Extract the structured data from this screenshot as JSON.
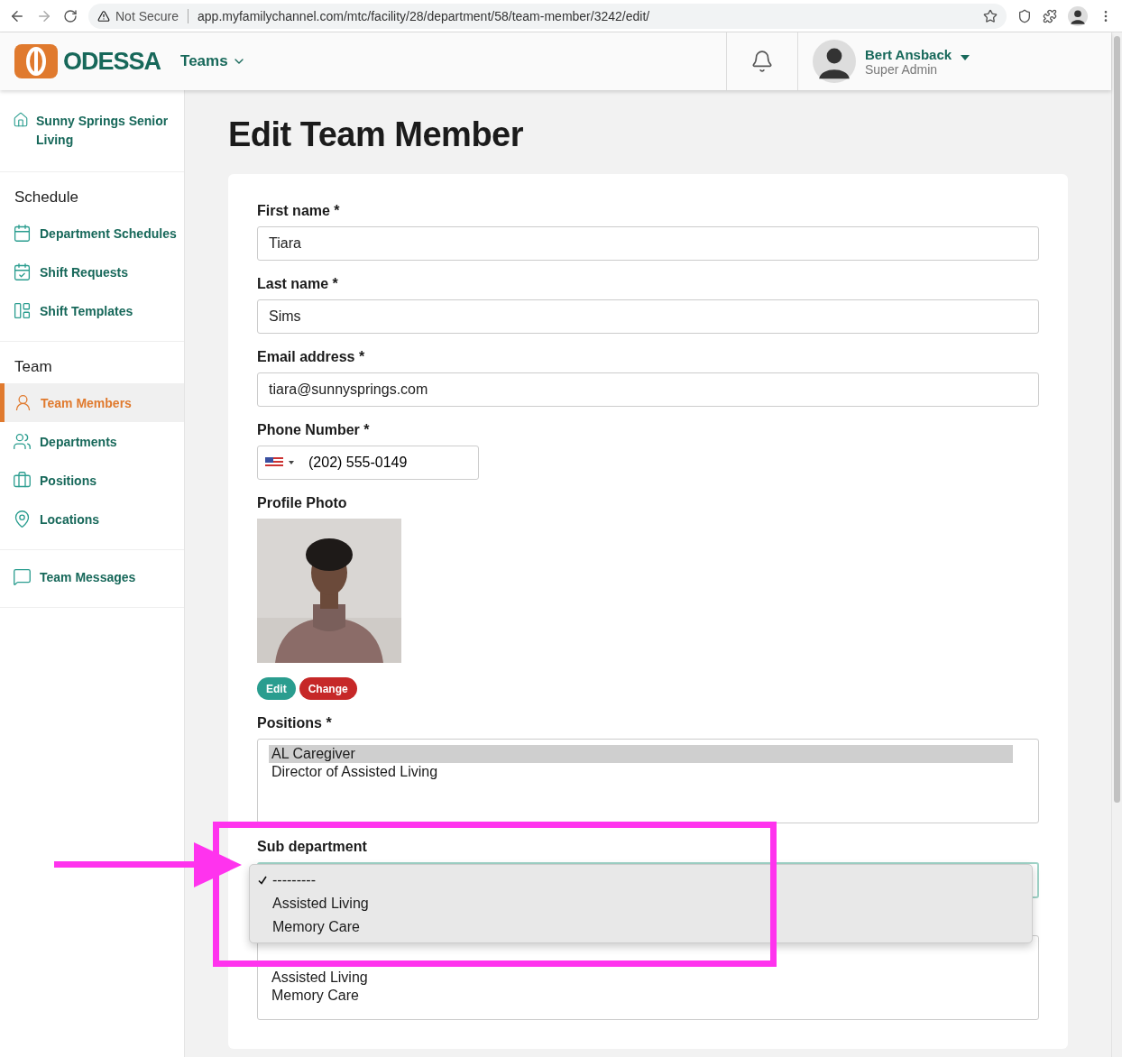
{
  "browser": {
    "security": "Not Secure",
    "url": "app.myfamilychannel.com/mtc/facility/28/department/58/team-member/3242/edit/"
  },
  "header": {
    "logo": "ODESSA",
    "menu": "Teams",
    "user": {
      "name": "Bert Ansback",
      "role": "Super Admin"
    }
  },
  "sidebar": {
    "facility": "Sunny Springs Senior Living",
    "sections": [
      {
        "title": "Schedule",
        "items": [
          {
            "label": "Department Schedules",
            "selected": false
          },
          {
            "label": "Shift Requests",
            "selected": false
          },
          {
            "label": "Shift Templates",
            "selected": false
          }
        ]
      },
      {
        "title": "Team",
        "items": [
          {
            "label": "Team Members",
            "selected": true
          },
          {
            "label": "Departments",
            "selected": false
          },
          {
            "label": "Positions",
            "selected": false
          },
          {
            "label": "Locations",
            "selected": false
          }
        ]
      },
      {
        "items": [
          {
            "label": "Team Messages",
            "selected": false
          }
        ]
      }
    ]
  },
  "page": {
    "title": "Edit Team Member"
  },
  "form": {
    "fields": [
      {
        "kind": "text",
        "label": "First name *",
        "value": "Tiara"
      },
      {
        "kind": "text",
        "label": "Last name *",
        "value": "Sims"
      },
      {
        "kind": "text",
        "label": "Email address *",
        "value": "tiara@sunnysprings.com"
      },
      {
        "kind": "phone",
        "label": "Phone Number *",
        "value": "(202) 555-0149"
      },
      {
        "label": "Profile Photo",
        "buttons": [
          "Edit",
          "Change"
        ]
      },
      {
        "kind": "listbox",
        "label": "Positions *",
        "options": [
          {
            "label": "AL Caregiver",
            "selected": true
          },
          {
            "label": "Director of Assisted Living",
            "selected": false
          }
        ]
      },
      {
        "kind": "select",
        "label": "Sub department",
        "expanded": true,
        "options": [
          {
            "label": "---------",
            "selected": true
          },
          {
            "label": "Assisted Living",
            "selected": false
          },
          {
            "label": "Memory Care",
            "selected": false
          }
        ]
      },
      {
        "kind": "listbox",
        "options": [
          {
            "label": "Assisted Living",
            "selected": false
          },
          {
            "label": "Memory Care",
            "selected": false
          }
        ]
      }
    ]
  }
}
